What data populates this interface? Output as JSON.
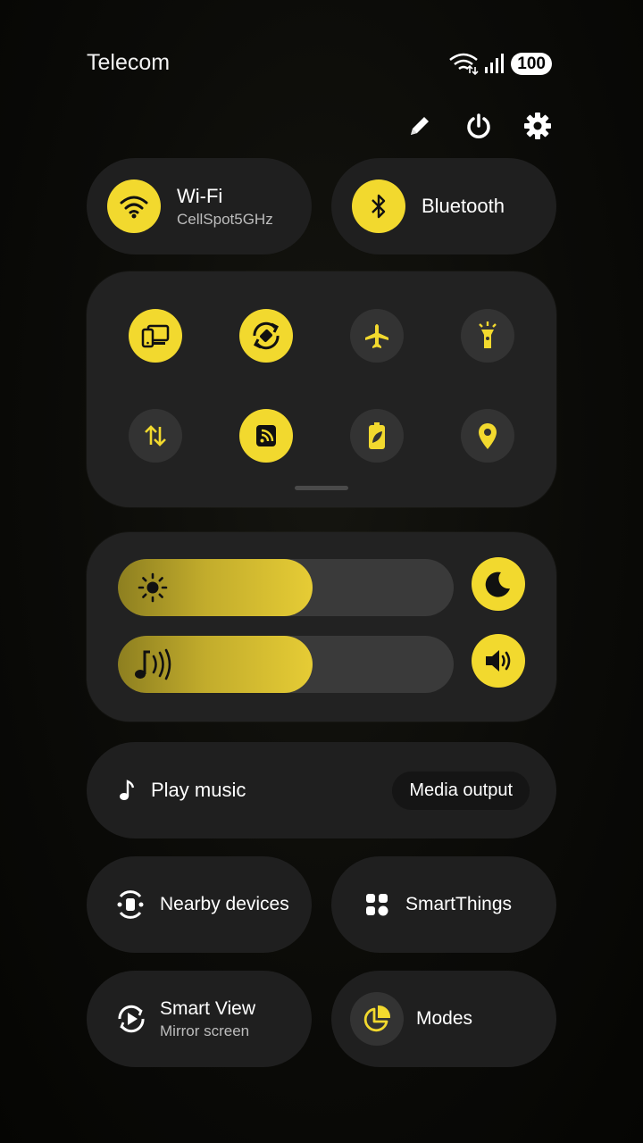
{
  "status_bar": {
    "carrier": "Telecom",
    "battery": "100",
    "icons": [
      "wifi-icon",
      "signal-icon"
    ]
  },
  "top_actions": [
    "edit-icon",
    "power-icon",
    "settings-icon"
  ],
  "wifi": {
    "label": "Wi-Fi",
    "network": "CellSpot5GHz",
    "on": true
  },
  "bluetooth": {
    "label": "Bluetooth",
    "on": true
  },
  "quick_toggles": [
    {
      "name": "screen-share-icon",
      "on": true
    },
    {
      "name": "auto-rotate-icon",
      "on": true
    },
    {
      "name": "airplane-icon",
      "on": false
    },
    {
      "name": "flashlight-icon",
      "on": false
    },
    {
      "name": "mobile-data-icon",
      "on": false
    },
    {
      "name": "nfc-icon",
      "on": true
    },
    {
      "name": "power-saving-icon",
      "on": false
    },
    {
      "name": "location-icon",
      "on": false
    }
  ],
  "sliders": {
    "brightness_level": 0.58,
    "volume_level": 0.58
  },
  "media": {
    "play_label": "Play music",
    "output_label": "Media output"
  },
  "tiles": {
    "nearby": "Nearby devices",
    "smartthings": "SmartThings",
    "smartview_title": "Smart View",
    "smartview_sub": "Mirror screen",
    "modes": "Modes"
  },
  "colors": {
    "accent": "#f2d92e",
    "panel": "#222222",
    "tile_off": "#333333"
  }
}
